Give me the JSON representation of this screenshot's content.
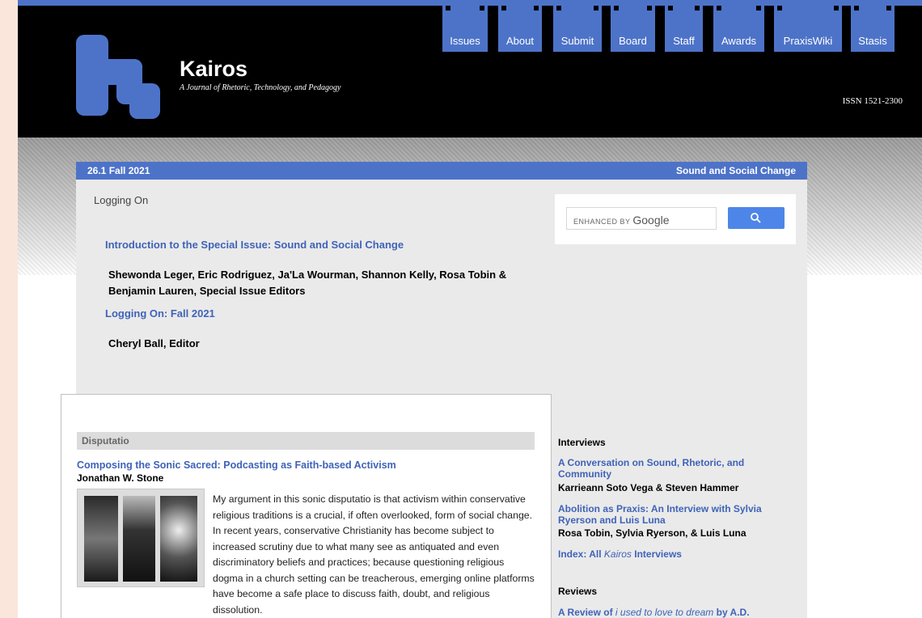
{
  "header": {
    "title": "Kairos",
    "subtitle": "A Journal of Rhetoric, Technology, and Pedagogy",
    "issn": "ISSN 1521-2300",
    "brand_color": "#4d73c9"
  },
  "nav": [
    "Issues",
    "About",
    "Submit",
    "Board",
    "Staff",
    "Awards",
    "PraxisWiki",
    "Stasis"
  ],
  "issue_bar": {
    "left": "26.1 Fall 2021",
    "right": "Sound and Social Change"
  },
  "logging": {
    "heading": "Logging On",
    "intro_link": "Introduction to the Special Issue: Sound and Social Change",
    "editors": "Shewonda Leger, Eric Rodriguez, Ja'La Wourman, Shannon Kelly, Rosa Tobin & Benjamin Lauren, Special Issue Editors",
    "logon_link": "Logging On: Fall 2021",
    "editor": "Cheryl Ball, Editor"
  },
  "search": {
    "label": "ENHANCED BY",
    "brand": "Google",
    "button_icon": "search-icon"
  },
  "disputatio": {
    "heading": "Disputatio",
    "article_title": "Composing the Sonic Sacred: Podcasting as Faith-based Activism",
    "author": "Jonathan W. Stone",
    "abstract": "My argument in this sonic disputatio is that activism within conservative religious traditions is a crucial, if often overlooked, form of social change. In recent years, conservative Christianity has become subject to increased scrutiny due to what many see as antiquated and even discriminatory beliefs and practices; because questioning religious dogma in a church setting can be treacherous, emerging online platforms have become a safe place to discuss faith, doubt, and religious dissolution."
  },
  "interviews": {
    "heading": "Interviews",
    "items": [
      {
        "title": "A Conversation on Sound, Rhetoric, and Community",
        "authors": "Karrieann Soto Vega & Steven Hammer"
      },
      {
        "title": "Abolition as Praxis: An Interview with Sylvia Ryerson and Luis Luna",
        "authors": "Rosa Tobin, Sylvia Ryerson, & Luis Luna"
      }
    ],
    "index_prefix": "Index: All ",
    "index_italic": "Kairos",
    "index_suffix": " Interviews"
  },
  "reviews": {
    "heading": "Reviews",
    "item_prefix": "A Review of ",
    "item_italic": "i used to love to dream",
    "item_suffix": " by A.D."
  }
}
